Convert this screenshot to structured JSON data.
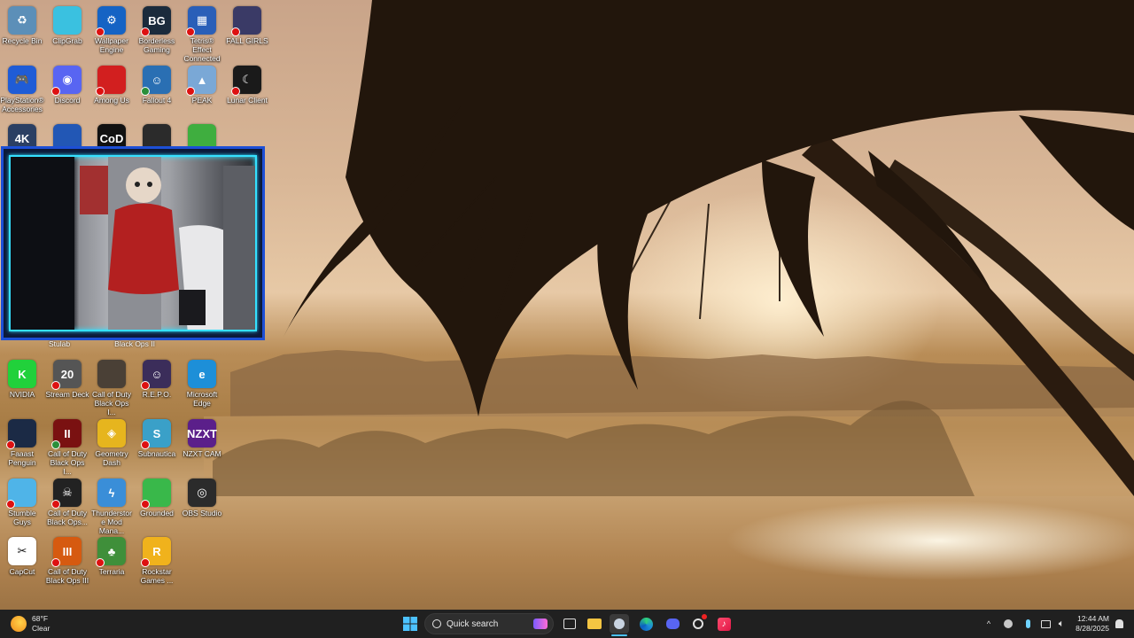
{
  "desktop": {
    "icons": [
      {
        "label": "Recycle Bin",
        "glyph": "♻",
        "color": "#5c8fb8",
        "badge": ""
      },
      {
        "label": "ClipGrab",
        "glyph": "",
        "color": "#3ac1e0",
        "badge": ""
      },
      {
        "label": "Wallpaper Engine",
        "glyph": "⚙",
        "color": "#1563c4",
        "badge": "x"
      },
      {
        "label": "Borderless Gaming",
        "glyph": "BG",
        "color": "#1b2b3c",
        "badge": "x"
      },
      {
        "label": "Tetris® Effect Connected",
        "glyph": "▦",
        "color": "#2a5fb8",
        "badge": "x"
      },
      {
        "label": "FALL GIRLS",
        "glyph": "",
        "color": "#3a3a66",
        "badge": "x"
      },
      {
        "label": "PlayStation® Accessories",
        "glyph": "🎮",
        "color": "#1f5cd6",
        "badge": ""
      },
      {
        "label": "Discord",
        "glyph": "◉",
        "color": "#5865f2",
        "badge": "x"
      },
      {
        "label": "Among Us",
        "glyph": "",
        "color": "#d21f1f",
        "badge": "x"
      },
      {
        "label": "Fallout 4",
        "glyph": "☺",
        "color": "#2a6fb3",
        "badge": "ok"
      },
      {
        "label": "PEAK",
        "glyph": "▲",
        "color": "#7aa8d6",
        "badge": "x"
      },
      {
        "label": "Lunar Client",
        "glyph": "☾",
        "color": "#1a1a1a",
        "badge": "x"
      },
      {
        "label": "",
        "glyph": "4K",
        "color": "#2b3f63",
        "badge": ""
      },
      {
        "label": "",
        "glyph": "",
        "color": "#2257b5",
        "badge": ""
      },
      {
        "label": "",
        "glyph": "CoD",
        "color": "#111111",
        "badge": ""
      },
      {
        "label": "",
        "glyph": "",
        "color": "#2b2b2b",
        "badge": ""
      },
      {
        "label": "",
        "glyph": "",
        "color": "#3fae3f",
        "badge": ""
      },
      {
        "label": "NVIDIA",
        "glyph": "K",
        "color": "#21d13b",
        "badge": ""
      },
      {
        "label": "Stream Deck",
        "glyph": "20",
        "color": "#555555",
        "badge": "x"
      },
      {
        "label": "Call of Duty Black Ops I...",
        "glyph": "",
        "color": "#4a4036",
        "badge": ""
      },
      {
        "label": "R.E.P.O.",
        "glyph": "☺",
        "color": "#3b2d5a",
        "badge": "x"
      },
      {
        "label": "Microsoft Edge",
        "glyph": "e",
        "color": "#1d8fd8",
        "badge": ""
      },
      {
        "label": "Faaast Penguin",
        "glyph": "",
        "color": "#1b2a45",
        "badge": "x"
      },
      {
        "label": "Call of Duty Black Ops I...",
        "glyph": "II",
        "color": "#7a1111",
        "badge": "ok"
      },
      {
        "label": "Geometry Dash",
        "glyph": "◈",
        "color": "#e6b51e",
        "badge": ""
      },
      {
        "label": "Subnautica",
        "glyph": "S",
        "color": "#3aa0c8",
        "badge": "x"
      },
      {
        "label": "NZXT CAM",
        "glyph": "NZXT",
        "color": "#5b1f8a",
        "badge": ""
      },
      {
        "label": "Stumble Guys",
        "glyph": "",
        "color": "#4fb4e8",
        "badge": "x"
      },
      {
        "label": "Call of Duty Black Ops...",
        "glyph": "☠",
        "color": "#222222",
        "badge": "x"
      },
      {
        "label": "Thunderstore Mod Mana...",
        "glyph": "ϟ",
        "color": "#3a8ed8",
        "badge": ""
      },
      {
        "label": "Grounded",
        "glyph": "",
        "color": "#39b84a",
        "badge": "x"
      },
      {
        "label": "OBS Studio",
        "glyph": "◎",
        "color": "#2b2b2b",
        "badge": ""
      },
      {
        "label": "CapCut",
        "glyph": "✂",
        "color": "#ffffff",
        "badge": ""
      },
      {
        "label": "Call of Duty Black Ops III",
        "glyph": "III",
        "color": "#d65a10",
        "badge": "x"
      },
      {
        "label": "Terraria",
        "glyph": "♣",
        "color": "#3f8f3a",
        "badge": "x"
      },
      {
        "label": "Rockstar Games ...",
        "glyph": "R",
        "color": "#f0b21c",
        "badge": "x"
      }
    ],
    "hidden_labels": [
      "Stulab",
      "Black Ops II"
    ]
  },
  "webcam_overlay": {
    "border_color": "#1d4fd6",
    "glow_color": "#35e0ff"
  },
  "taskbar": {
    "weather": {
      "temp": "68°F",
      "condition": "Clear"
    },
    "search_placeholder": "Quick search",
    "apps": [
      "start-icon",
      "task-view-icon",
      "file-explorer-icon",
      "steam-icon",
      "edge-icon",
      "discord-icon",
      "settings-icon",
      "music-icon"
    ],
    "clock": {
      "time": "12:44 AM",
      "date": "8/28/2025"
    }
  }
}
